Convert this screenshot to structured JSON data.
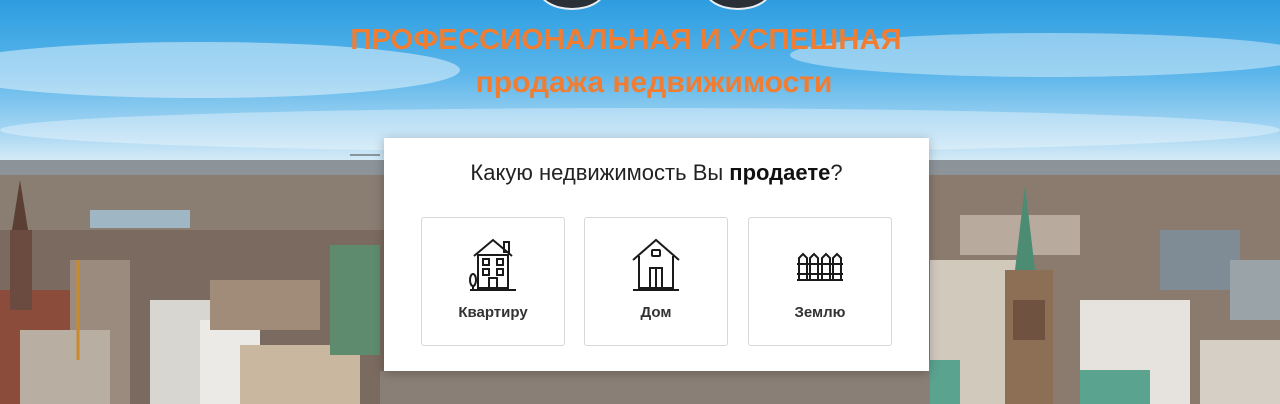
{
  "hero": {
    "headline_line1": "ПРОФЕССИОНАЛЬНАЯ И УСПЕШНАЯ",
    "headline_line2": "продажа недвижимости",
    "accent_color": "#f07d32"
  },
  "card": {
    "question_before": "Какую недвижимость Вы ",
    "question_bold": "продаете",
    "question_after": "?",
    "options": [
      {
        "label": "Квартиру",
        "icon": "apartment-building-icon"
      },
      {
        "label": "Дом",
        "icon": "house-icon"
      },
      {
        "label": "Землю",
        "icon": "fenced-land-icon"
      }
    ]
  }
}
